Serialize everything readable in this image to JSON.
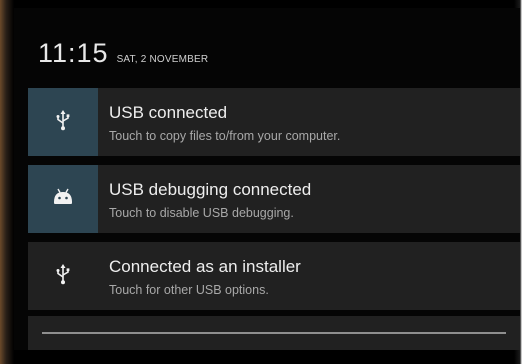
{
  "status": {
    "time": "11:15",
    "date": "SAT, 2 NOVEMBER"
  },
  "notifications": [
    {
      "icon": "usb-icon",
      "title": "USB connected",
      "subtitle": "Touch to copy files to/from your computer."
    },
    {
      "icon": "android-icon",
      "title": "USB debugging connected",
      "subtitle": "Touch to disable USB debugging."
    },
    {
      "icon": "usb-icon",
      "title": "Connected as an installer",
      "subtitle": "Touch for other USB options."
    }
  ],
  "colors": {
    "shade_background": "#050505",
    "notification_background": "#212121",
    "icon_highlight": "#2d4552"
  }
}
